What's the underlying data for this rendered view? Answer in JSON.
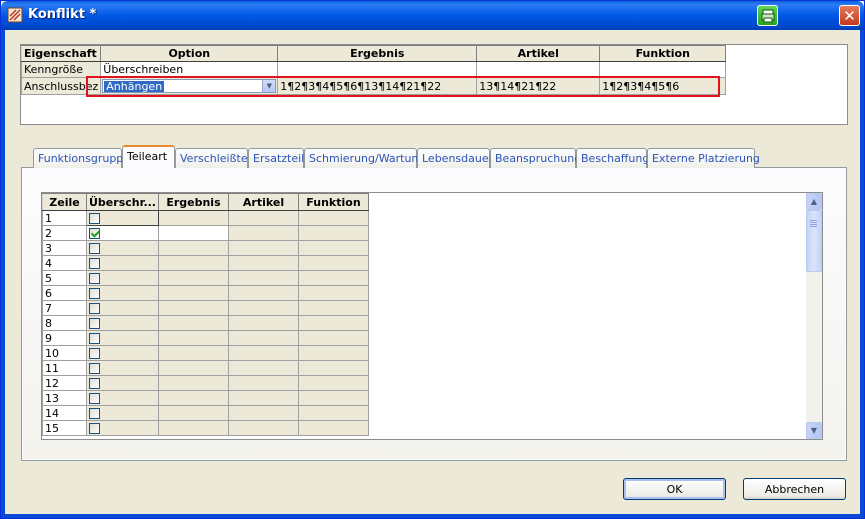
{
  "window": {
    "title": "Konflikt *"
  },
  "top_grid": {
    "headers": [
      "Eigenschaft",
      "Option",
      "Ergebnis",
      "Artikel",
      "Funktion"
    ],
    "rows": [
      {
        "label": "Kenngröße",
        "option": "Überschreiben",
        "ergebnis": "",
        "artikel": "",
        "funktion": ""
      },
      {
        "label": "Anschlussbez",
        "option": "Anhängen",
        "ergebnis": "1¶2¶3¶4¶5¶6¶13¶14¶21¶22",
        "artikel": "13¶14¶21¶22",
        "funktion": "1¶2¶3¶4¶5¶6"
      }
    ]
  },
  "tabs": [
    "Funktionsgruppe",
    "Teileart",
    "Verschleißteil",
    "Ersatzteil",
    "Schmierung/Wartung",
    "Lebensdauer",
    "Beanspruchung",
    "Beschaffung",
    "Externe Platzierung"
  ],
  "active_tab": "Teileart",
  "inner_grid": {
    "headers": [
      "Zeile",
      "Überschr...",
      "Ergebnis",
      "Artikel",
      "Funktion"
    ],
    "rows": [
      "1",
      "2",
      "3",
      "4",
      "5",
      "6",
      "7",
      "8",
      "9",
      "10",
      "11",
      "12",
      "13",
      "14",
      "15"
    ],
    "checked_row": "2"
  },
  "buttons": {
    "ok": "OK",
    "cancel": "Abbrechen"
  }
}
